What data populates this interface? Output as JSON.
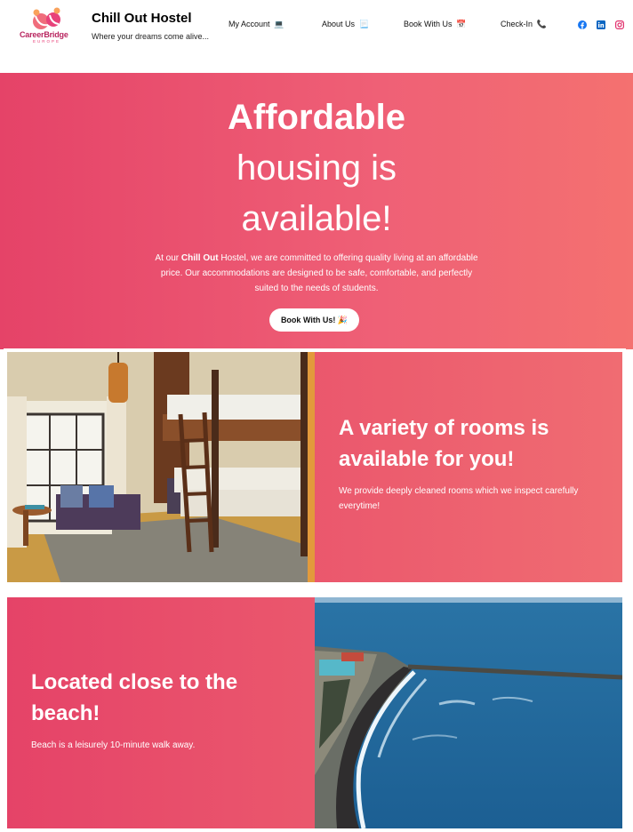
{
  "header": {
    "logo_word": "CareerBridge",
    "logo_sub": "EUROPE",
    "site_title": "Chill Out Hostel",
    "tagline": "Where your dreams come alive...",
    "nav": [
      {
        "label": "My Account",
        "emoji": "💻"
      },
      {
        "label": "About Us",
        "emoji": "📃"
      },
      {
        "label": "Book With Us",
        "emoji": "📅"
      },
      {
        "label": "Check-In",
        "emoji": "📞"
      }
    ],
    "social_icons": [
      "facebook-icon",
      "linkedin-icon",
      "instagram-icon"
    ]
  },
  "hero": {
    "title_line1": "Affordable",
    "title_line2": "housing is",
    "title_line3": "available!",
    "text_prefix": "At our ",
    "text_bold": "Chill Out",
    "text_rest": " Hostel, we are committed to offering quality living at an affordable price. Our accommodations are designed to be safe, comfortable, and perfectly suited to the needs of students.",
    "button_label": "Book With Us! 🎉"
  },
  "sections": [
    {
      "title": "A variety of rooms is available for you!",
      "text": "We provide deeply cleaned rooms which we inspect carefully everytime!",
      "image": "bunk-bed-room-photo"
    },
    {
      "title": "Located close to the beach!",
      "text": "Beach is a leisurely 10-minute walk away.",
      "image": "beach-coast-photo"
    }
  ],
  "colors": {
    "gradient_start": "#e54368",
    "gradient_end": "#f47170",
    "facebook": "#1877f2",
    "linkedin": "#0a66c2",
    "instagram": "#e1306c"
  }
}
